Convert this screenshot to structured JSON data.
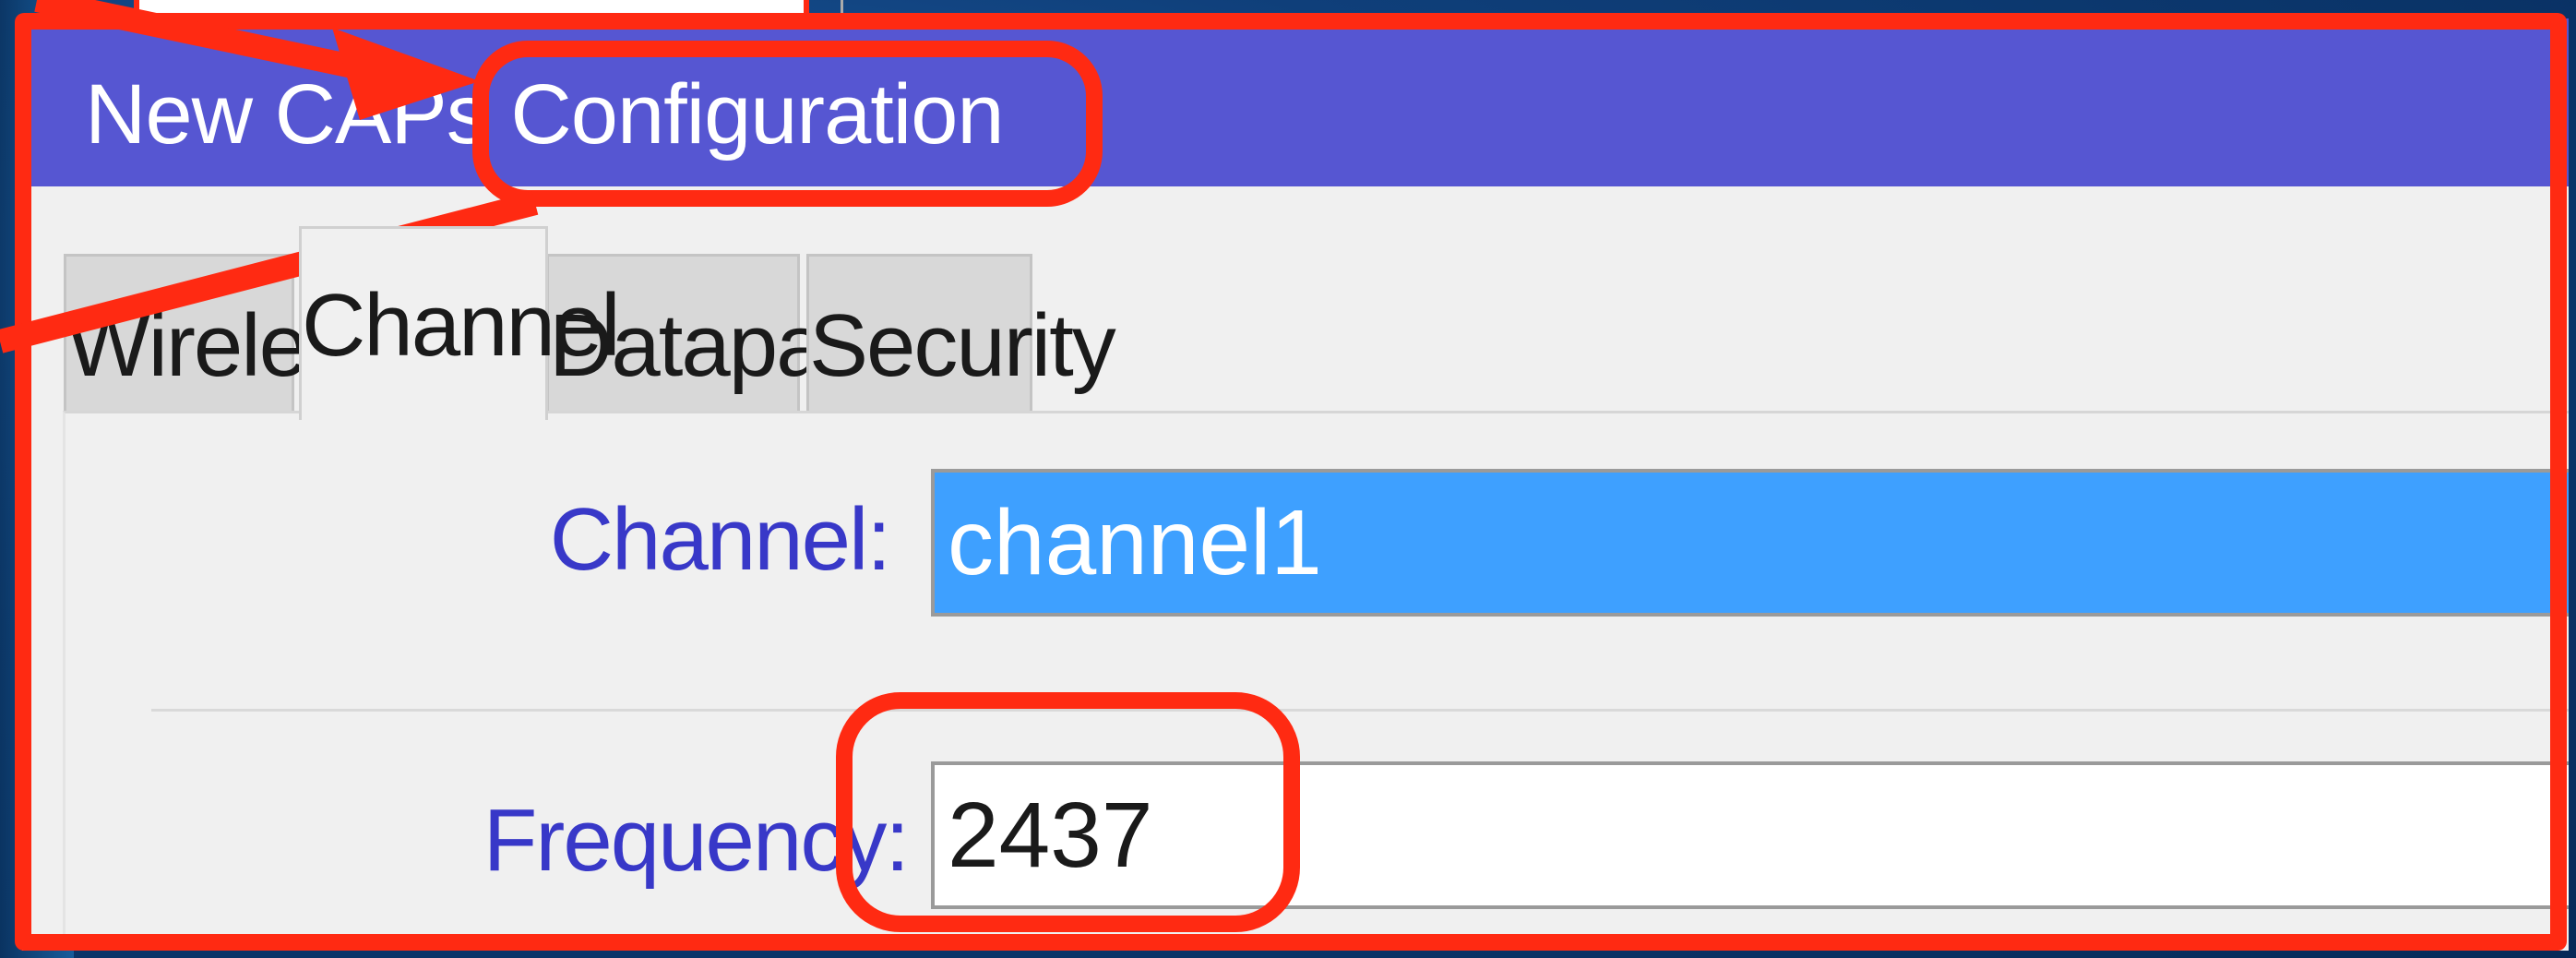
{
  "window": {
    "title": "New CAPs Configuration"
  },
  "tabs": [
    {
      "label": "Wireless",
      "active": false
    },
    {
      "label": "Channel",
      "active": true
    },
    {
      "label": "Datapath",
      "active": false
    },
    {
      "label": "Security",
      "active": false
    }
  ],
  "form": {
    "channel_label": "Channel:",
    "channel_value": "channel1",
    "frequency_label": "Frequency:",
    "frequency_value": "2437"
  },
  "annotations": {
    "color": "#ff2a12",
    "highlights": [
      "window-title-configuration",
      "frequency-value"
    ],
    "arrows": [
      "arrow-to-title",
      "arrow-left"
    ]
  },
  "colors": {
    "titlebar": "#5656d2",
    "selected_field": "#3ea0ff",
    "label_text": "#3838c8"
  }
}
